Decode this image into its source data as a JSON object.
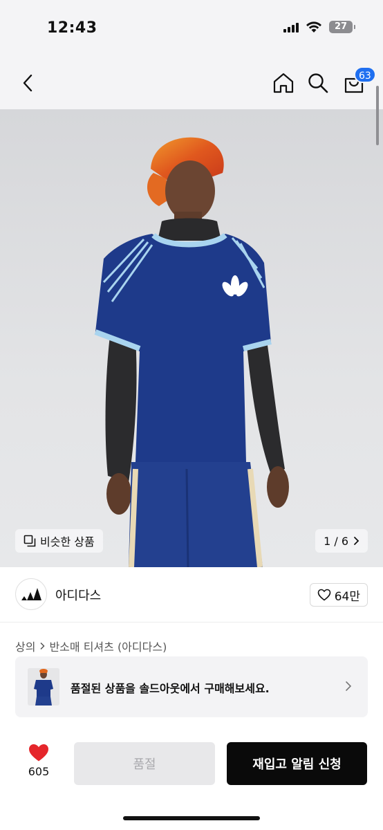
{
  "status_bar": {
    "time": "12:43",
    "battery": "27"
  },
  "nav": {
    "cart_badge": "63",
    "icons": [
      "chevron-left-icon",
      "home-icon",
      "search-icon",
      "cart-icon"
    ]
  },
  "gallery": {
    "similar_label": "비슷한 상품",
    "page_counter": "1 / 6",
    "background_color": "#dcdde0"
  },
  "brand": {
    "name": "아디다스",
    "likes": "64만"
  },
  "breadcrumb": {
    "category": "상의",
    "subcategory": "반소매 티셔츠 (아디다스)"
  },
  "soldout_banner": {
    "text": "품절된 상품을 솔드아웃에서 구매해보세요."
  },
  "actions": {
    "heart_count": "605",
    "soldout_label": "품절",
    "restock_label": "재입고 알림 신청"
  },
  "colors": {
    "accent_blue": "#1f6ff0",
    "heart_red": "#e5262b",
    "primary_black": "#0a0a0a",
    "disabled_gray": "#e8e8ea"
  }
}
